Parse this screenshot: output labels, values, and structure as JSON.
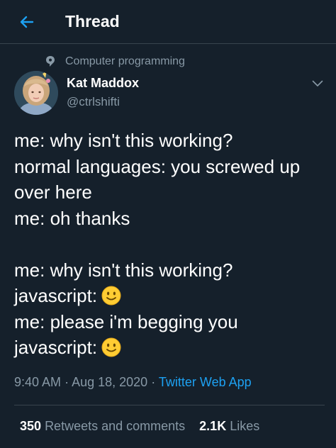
{
  "header": {
    "title": "Thread",
    "back_icon": "back-arrow-icon",
    "accent_color": "#1da1f2"
  },
  "topic": {
    "icon": "topic-speech-bubble-icon",
    "label": "Computer programming"
  },
  "author": {
    "name": "Kat Maddox",
    "handle": "@ctrlshifti",
    "avatar_icon": "avatar"
  },
  "tweet": {
    "lines": [
      "me: why isn't this working?",
      "normal languages: you screwed up",
      "over here",
      "me: oh thanks",
      "",
      "me: why isn't this working?",
      "javascript:",
      "me: please i'm begging you",
      "javascript:"
    ],
    "emoji": "slightly-smiling-face-icon"
  },
  "meta": {
    "time": "9:40 AM",
    "separator": "·",
    "date": "Aug 18, 2020",
    "source": "Twitter Web App"
  },
  "stats": {
    "retweets_count": "350",
    "retweets_label": "Retweets and comments",
    "likes_count": "2.1K",
    "likes_label": "Likes"
  },
  "colors": {
    "background": "#15202b",
    "secondary_text": "#8899a6",
    "divider": "#38444d",
    "link": "#1da1f2"
  }
}
